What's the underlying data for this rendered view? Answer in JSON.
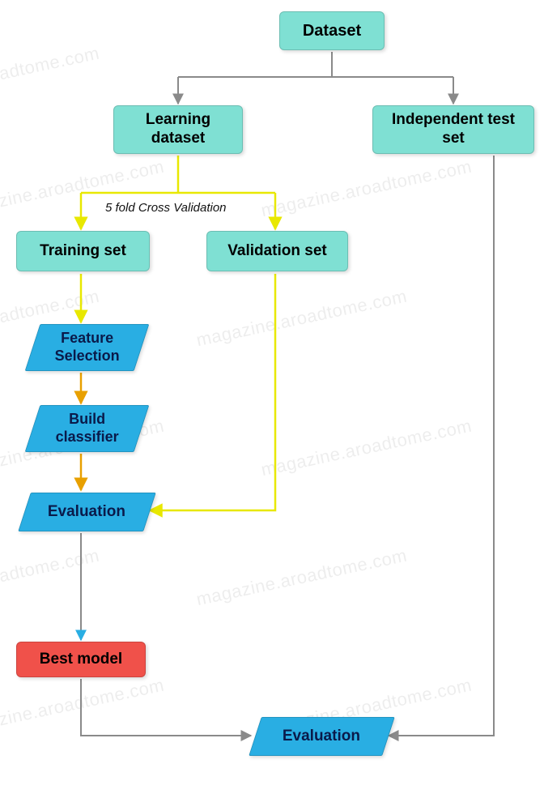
{
  "nodes": {
    "dataset": "Dataset",
    "learning_dataset": "Learning dataset",
    "independent_test_set": "Independent test set",
    "training_set": "Training set",
    "validation_set": "Validation set",
    "feature_selection": "Feature Selection",
    "build_classifier": "Build classifier",
    "evaluation_1": "Evaluation",
    "best_model": "Best model",
    "evaluation_2": "Evaluation"
  },
  "labels": {
    "cross_validation": "5 fold Cross Validation"
  },
  "watermark_text": "magazine.aroadtome.com",
  "colors": {
    "teal": "#7FE0D3",
    "blue": "#29AEE3",
    "red": "#F0514A",
    "arrow_gray": "#8A8A8A",
    "arrow_yellow": "#E8E800",
    "arrow_orange": "#E8A000"
  }
}
